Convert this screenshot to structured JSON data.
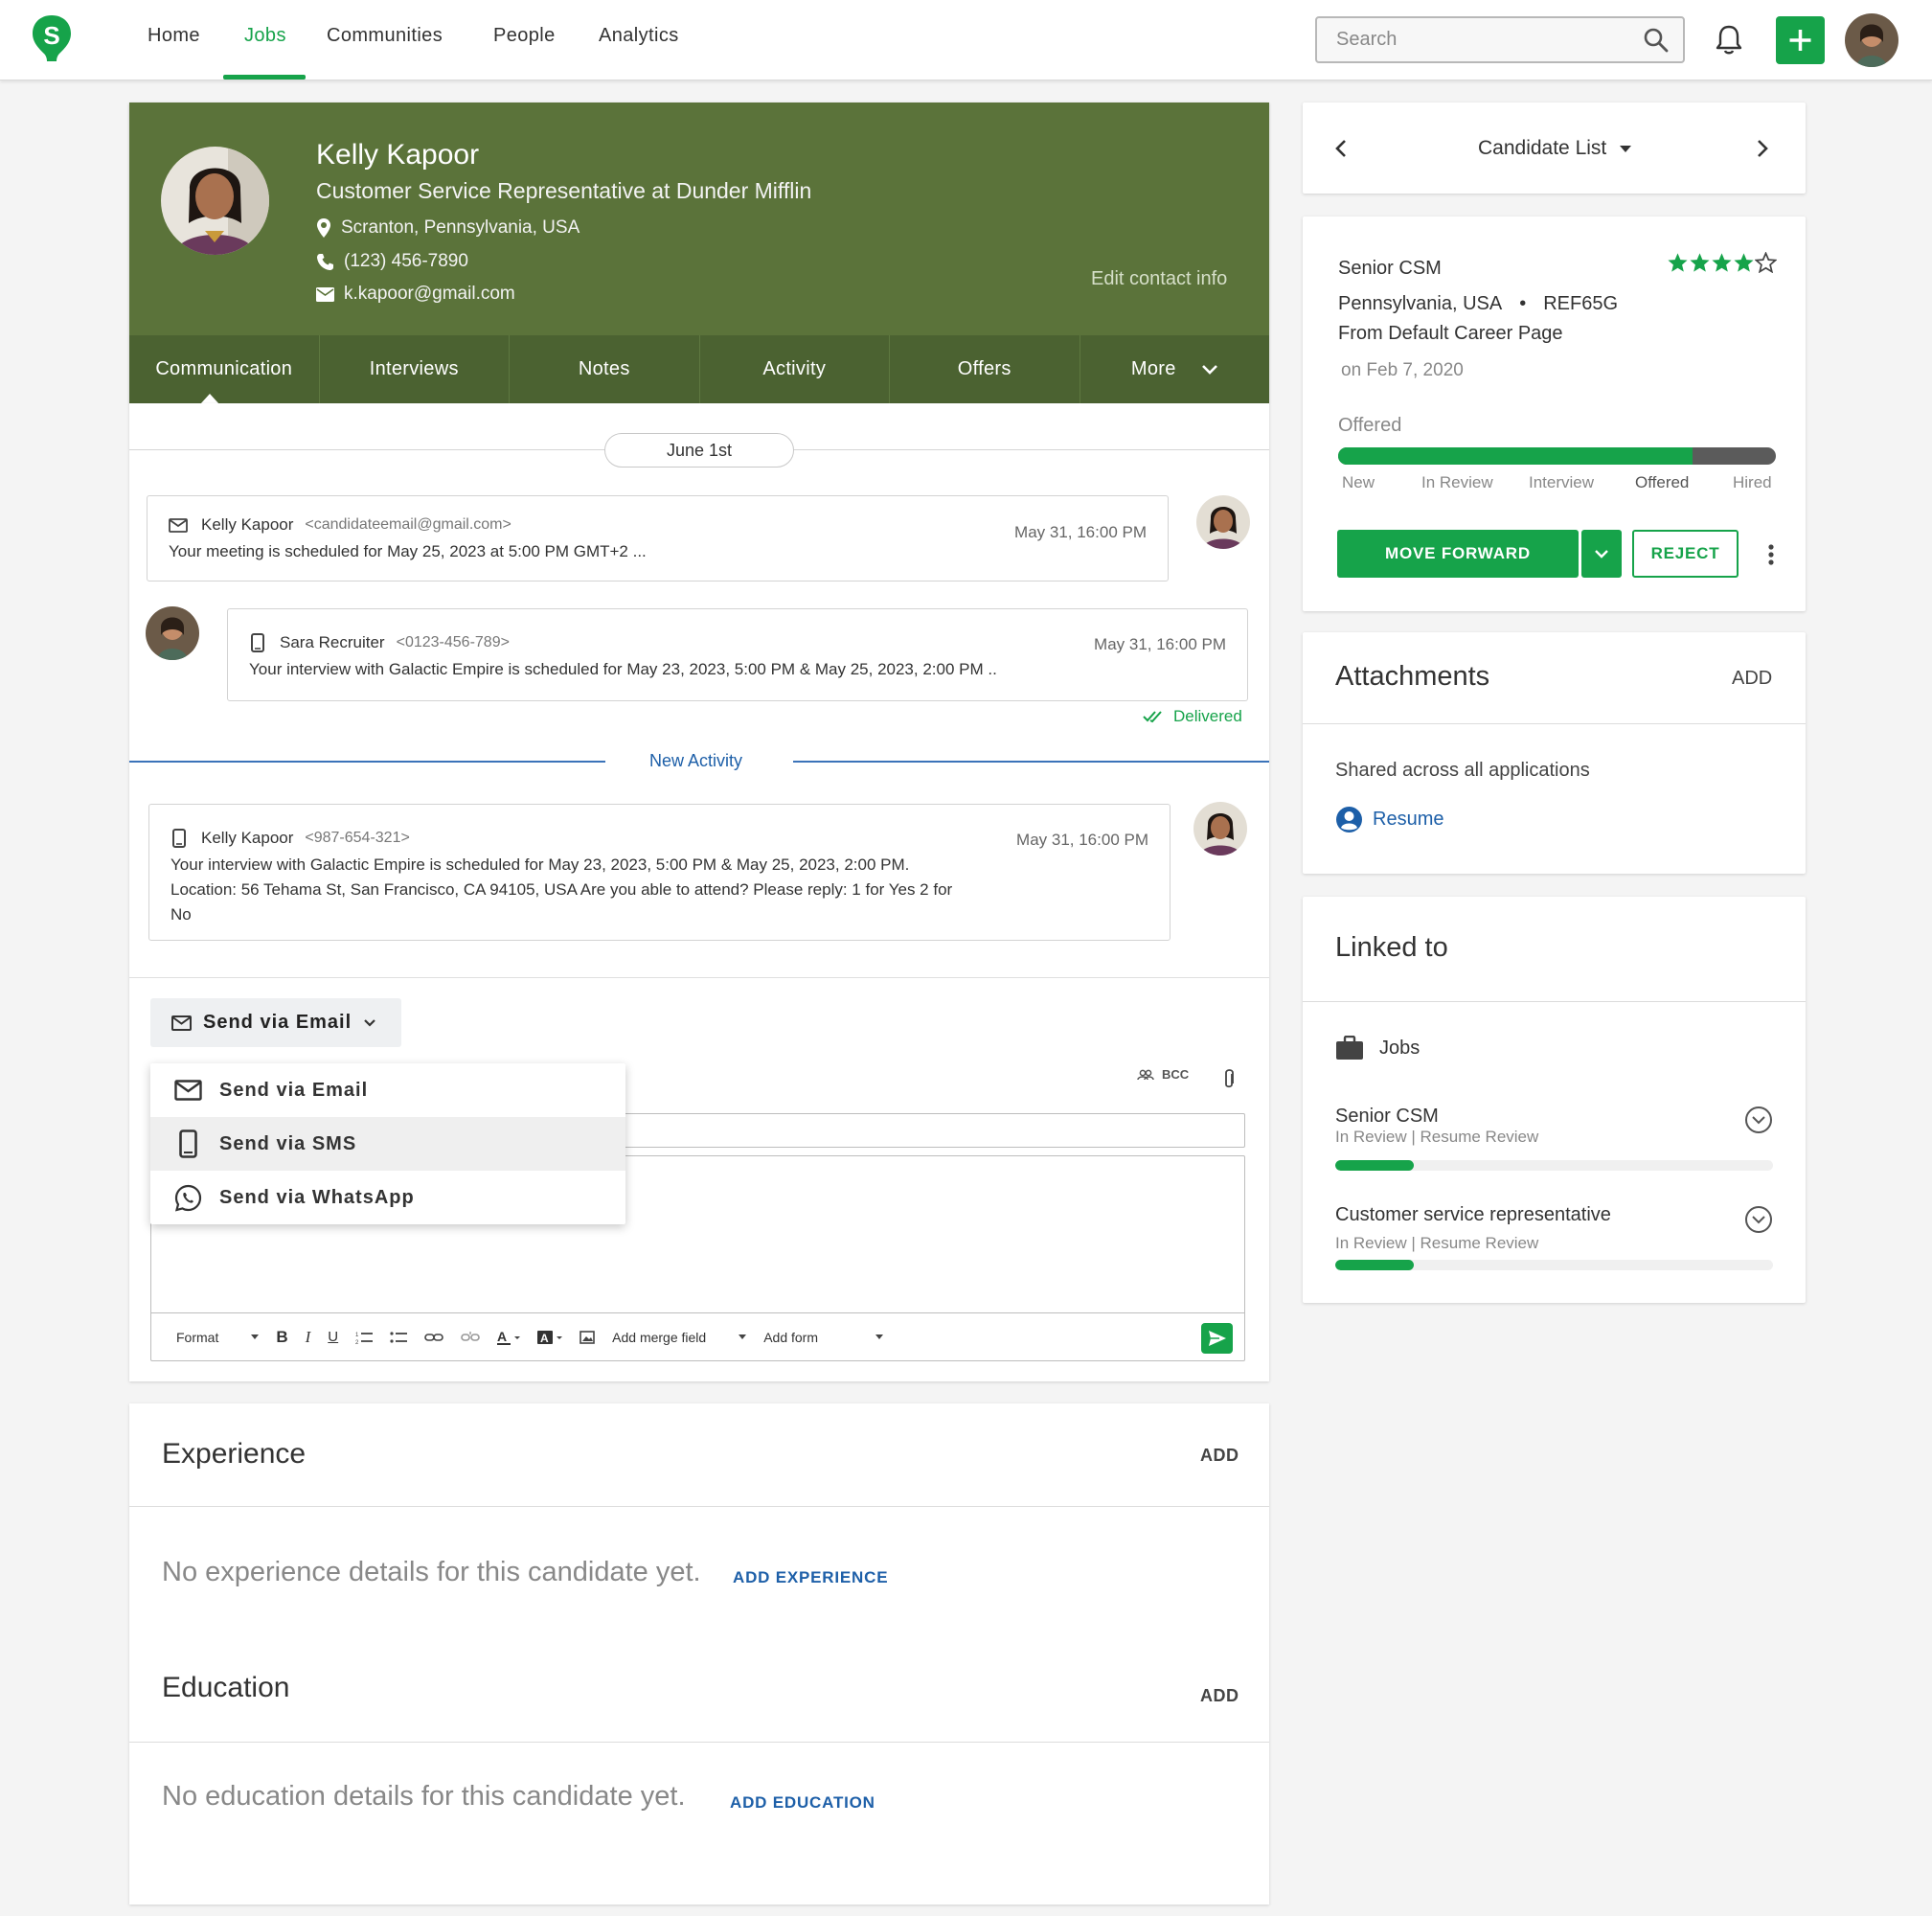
{
  "nav": {
    "logo_letter": "S",
    "items": [
      "Home",
      "Jobs",
      "Communities",
      "People",
      "Analytics"
    ],
    "active": "Jobs",
    "search_placeholder": "Search"
  },
  "candidate": {
    "name": "Kelly Kapoor",
    "title": "Customer Service Representative at Dunder Mifflin",
    "location": "Scranton, Pennsylvania, USA",
    "phone": "(123) 456-7890",
    "email": "k.kapoor@gmail.com",
    "edit_label": "Edit contact info"
  },
  "tabs": [
    "Communication",
    "Interviews",
    "Notes",
    "Activity",
    "Offers",
    "More"
  ],
  "communication": {
    "date_pill": "June 1st",
    "messages": [
      {
        "from": "Kelly Kapoor",
        "address": "<candidateemail@gmail.com>",
        "time": "May 31, 16:00 PM",
        "body": "Your meeting is scheduled for May 25, 2023 at 5:00 PM GMT+2 ..."
      },
      {
        "from": "Sara Recruiter",
        "address": "<0123-456-789>",
        "time": "May 31, 16:00 PM",
        "body": "Your interview with Galactic Empire is scheduled for May 23, 2023, 5:00 PM & May 25, 2023, 2:00 PM ..",
        "status": "Delivered"
      },
      {
        "from": "Kelly Kapoor",
        "address": "<987-654-321>",
        "time": "May 31, 16:00 PM",
        "body_lines": [
          "Your interview with Galactic Empire is scheduled for May 23, 2023, 5:00 PM & May 25, 2023, 2:00 PM.",
          "Location: 56 Tehama St, San Francisco, CA 94105, USA Are you able to attend? Please reply: 1 for Yes 2 for",
          "No"
        ]
      }
    ],
    "new_activity": "New Activity"
  },
  "composer": {
    "send_button": "Send via Email",
    "bcc": "BCC",
    "dropdown": [
      "Send via Email",
      "Send via SMS",
      "Send via WhatsApp"
    ],
    "toolbar": {
      "format": "Format",
      "merge_field": "Add merge field",
      "add_form": "Add form"
    }
  },
  "experience": {
    "title": "Experience",
    "add": "ADD",
    "empty": "No experience details for this candidate yet.",
    "link": "ADD EXPERIENCE"
  },
  "education": {
    "title": "Education",
    "add": "ADD",
    "empty": "No education details for this candidate yet.",
    "link": "ADD EDUCATION"
  },
  "candidate_list": {
    "title": "Candidate List"
  },
  "job_card": {
    "job": "Senior CSM",
    "rating": 4,
    "rating_max": 5,
    "location": "Pennsylvania, USA",
    "ref": "REF65G",
    "source": "From Default Career Page",
    "date": "on Feb 7, 2020",
    "stage": "Offered",
    "stage_progress": 0.81,
    "stages": [
      "New",
      "In Review",
      "Interview",
      "Offered",
      "Hired"
    ],
    "move_forward": "MOVE FORWARD",
    "reject": "REJECT"
  },
  "attachments": {
    "title": "Attachments",
    "add": "ADD",
    "shared": "Shared across all applications",
    "resume": "Resume"
  },
  "linked": {
    "title": "Linked to",
    "section": "Jobs",
    "jobs": [
      {
        "name": "Senior CSM",
        "status": "In Review",
        "step": "Resume Review",
        "progress": 0.18
      },
      {
        "name": "Customer service representative",
        "status": "In Review",
        "step": "Resume Review",
        "progress": 0.18
      }
    ]
  },
  "colors": {
    "brand_green": "#16a34a",
    "header_green": "#5b733a",
    "link_blue": "#1d5fa8"
  }
}
